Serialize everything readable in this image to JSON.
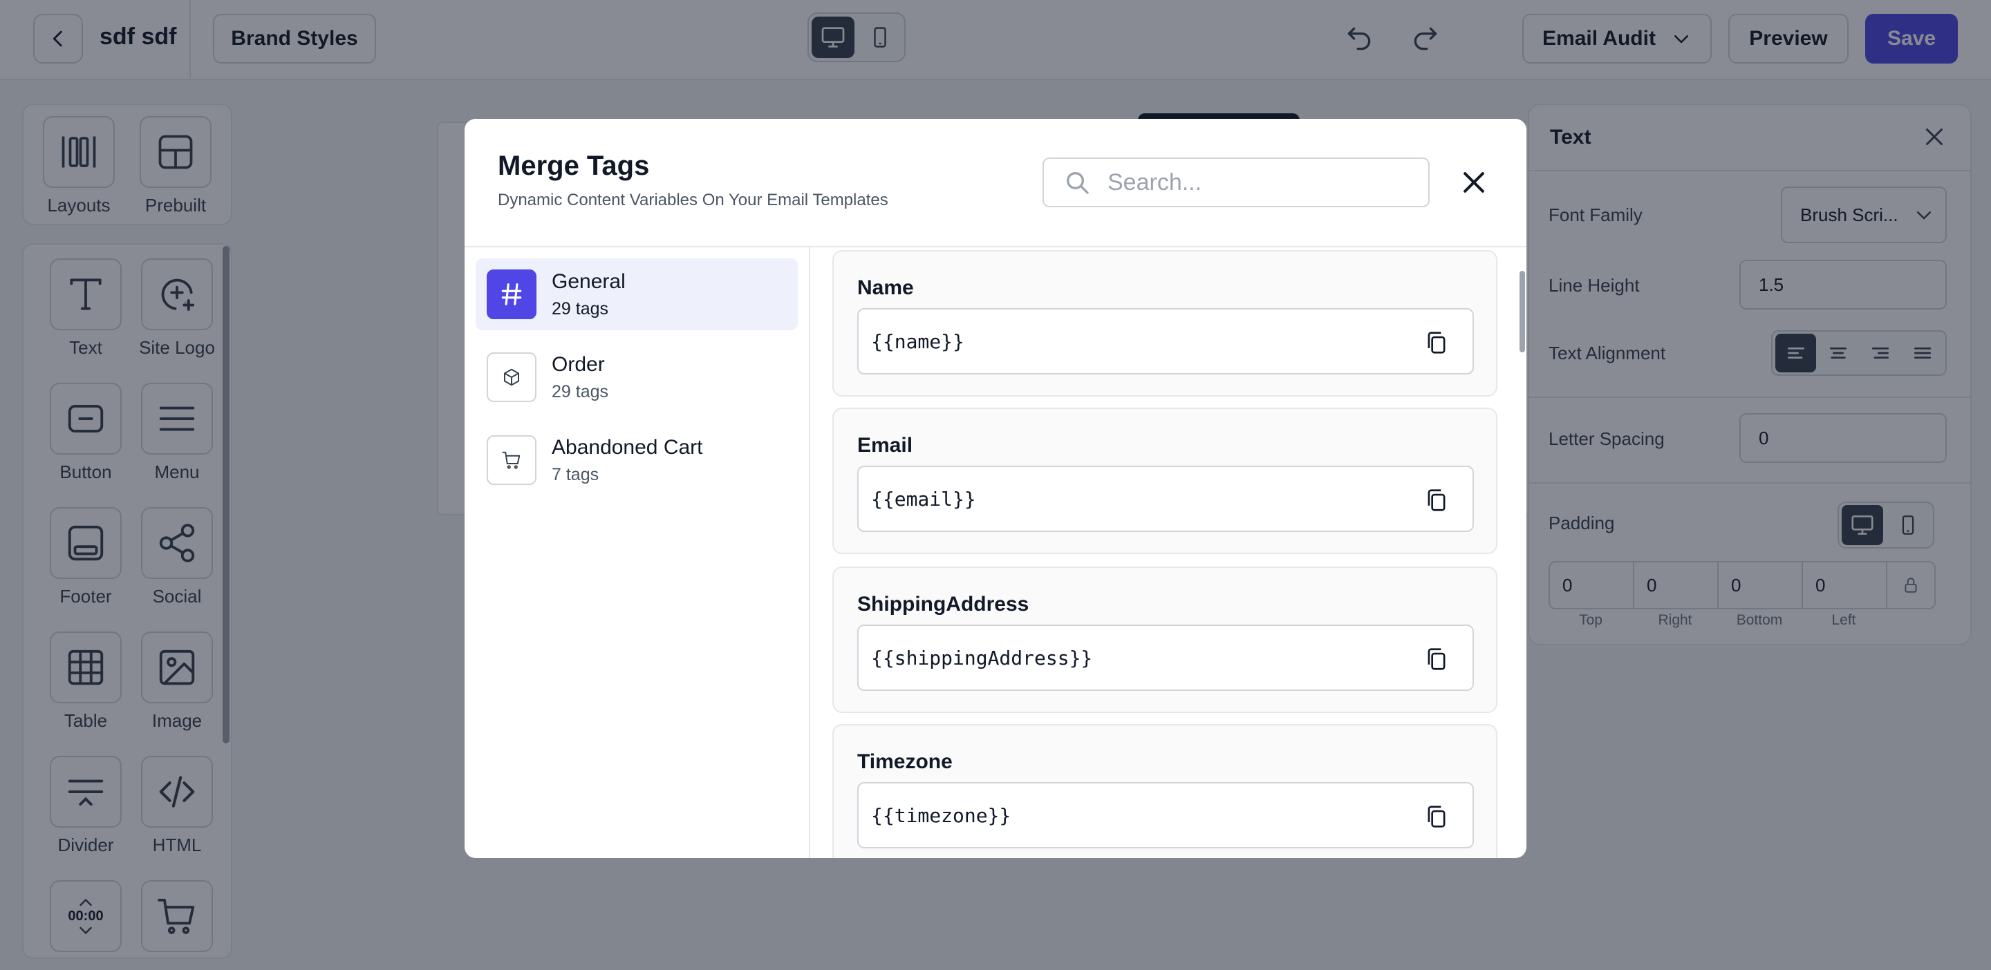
{
  "topbar": {
    "title": "sdf sdf",
    "brand_styles": "Brand Styles",
    "audit_label": "Email Audit",
    "preview_label": "Preview",
    "save_label": "Save",
    "accent": "#4f46e5"
  },
  "left_panel": {
    "top_tools": [
      {
        "label": "Layouts",
        "icon": "columns-icon"
      },
      {
        "label": "Prebuilt",
        "icon": "prebuilt-icon"
      }
    ],
    "tools": [
      {
        "label": "Text",
        "icon": "text-icon"
      },
      {
        "label": "Site Logo",
        "icon": "site-logo-icon"
      },
      {
        "label": "Button",
        "icon": "button-icon"
      },
      {
        "label": "Menu",
        "icon": "menu-icon"
      },
      {
        "label": "Footer",
        "icon": "footer-icon"
      },
      {
        "label": "Social",
        "icon": "share-icon"
      },
      {
        "label": "Table",
        "icon": "table-icon"
      },
      {
        "label": "Image",
        "icon": "image-icon"
      },
      {
        "label": "Divider",
        "icon": "divider-icon"
      },
      {
        "label": "HTML",
        "icon": "code-icon"
      },
      {
        "label": "",
        "icon": "timer-icon",
        "text": "00:00"
      },
      {
        "label": "",
        "icon": "cart-icon"
      }
    ]
  },
  "right_panel": {
    "title": "Text",
    "font_family_label": "Font Family",
    "font_family_value": "Brush Scri...",
    "line_height_label": "Line Height",
    "line_height_value": "1.5",
    "text_alignment_label": "Text Alignment",
    "letter_spacing_label": "Letter Spacing",
    "letter_spacing_value": "0",
    "padding_label": "Padding",
    "padding": {
      "top": "0",
      "right": "0",
      "bottom": "0",
      "left": "0",
      "top_label": "Top",
      "right_label": "Right",
      "bottom_label": "Bottom",
      "left_label": "Left"
    }
  },
  "modal": {
    "title": "Merge Tags",
    "subtitle": "Dynamic Content Variables On Your Email Templates",
    "search_placeholder": "Search...",
    "categories": [
      {
        "name": "General",
        "count": "29 tags",
        "icon": "hash-icon",
        "active": true
      },
      {
        "name": "Order",
        "count": "29 tags",
        "icon": "box-icon",
        "active": false
      },
      {
        "name": "Abandoned Cart",
        "count": "7 tags",
        "icon": "cart-icon",
        "active": false
      }
    ],
    "tags": [
      {
        "name": "Name",
        "value": "{{name}}"
      },
      {
        "name": "Email",
        "value": "{{email}}"
      },
      {
        "name": "ShippingAddress",
        "value": "{{shippingAddress}}"
      },
      {
        "name": "Timezone",
        "value": "{{timezone}}"
      }
    ]
  }
}
